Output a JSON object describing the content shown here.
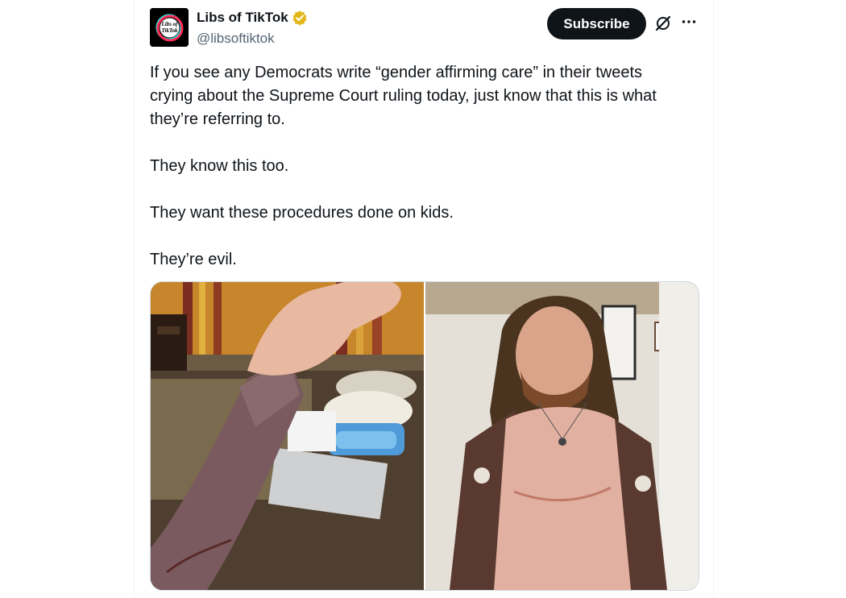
{
  "author": {
    "display_name": "Libs of TikTok",
    "handle": "@libsoftiktok",
    "verified": true,
    "avatar_text": "Libs of TikTok"
  },
  "actions": {
    "subscribe_label": "Subscribe",
    "grok_icon": "grok-icon",
    "more_icon": "more-icon"
  },
  "tweet": {
    "text": "If you see any Democrats write “gender affirming care” in their tweets\ncrying about the Supreme Court ruling today, just know that this is what\nthey’re referring to.\n\nThey know this too.\n\nThey want these procedures done on kids.\n\nThey’re evil."
  },
  "media": {
    "count": 2
  },
  "colors": {
    "text": "#0f1419",
    "secondary": "#536471",
    "verified_gold": "#e2b719",
    "button_bg": "#0f1419"
  }
}
